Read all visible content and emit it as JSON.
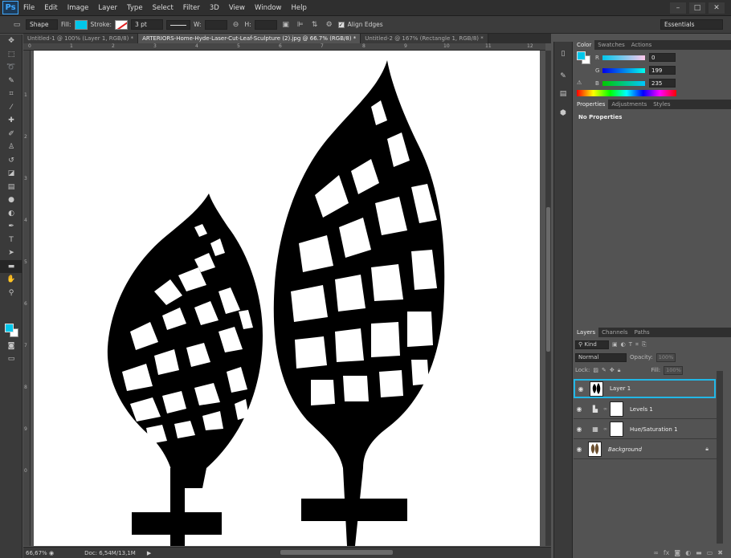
{
  "app": {
    "logo": "Ps"
  },
  "menu": [
    "File",
    "Edit",
    "Image",
    "Layer",
    "Type",
    "Select",
    "Filter",
    "3D",
    "View",
    "Window",
    "Help"
  ],
  "window_controls": [
    "–",
    "□",
    "✕"
  ],
  "options_bar": {
    "mode": "Shape",
    "fill_label": "Fill:",
    "stroke_label": "Stroke:",
    "stroke_width": "3 pt",
    "w_label": "W:",
    "h_label": "H:",
    "align_edges": "Align Edges",
    "workspace": "Essentials"
  },
  "doc_tabs": [
    "Untitled-1 @ 100% (Layer 1, RGB/8) *",
    "ARTERIORS-Home-Hyde-Laser-Cut-Leaf-Sculpture (2).jpg @ 66.7% (RGB/8) *",
    "Untitled-2 @ 167% (Rectangle 1, RGB/8) *"
  ],
  "ruler_top": [
    "0",
    "1",
    "2",
    "3",
    "4",
    "5",
    "6",
    "7",
    "8",
    "9",
    "10",
    "11",
    "12"
  ],
  "ruler_left": [
    "1",
    "2",
    "3",
    "4",
    "5",
    "6",
    "7",
    "8",
    "9",
    "0"
  ],
  "status": {
    "zoom": "66,67%",
    "doc": "Doc: 6,54M/13,1M"
  },
  "color_panel": {
    "tabs": [
      "Color",
      "Swatches",
      "Actions"
    ],
    "r_label": "R",
    "g_label": "G",
    "b_label": "B",
    "r": "0",
    "g": "199",
    "b": "235"
  },
  "properties_panel": {
    "tabs": [
      "Properties",
      "Adjustments",
      "Styles"
    ],
    "title": "No Properties"
  },
  "layers_panel": {
    "tabs": [
      "Layers",
      "Channels",
      "Paths"
    ],
    "kind": "Kind",
    "blend_mode": "Normal",
    "opacity_label": "Opacity:",
    "opacity": "100%",
    "lock_label": "Lock:",
    "fill_label": "Fill:",
    "fill": "100%",
    "layers": [
      {
        "name": "Layer 1",
        "selected": true,
        "type": "pixel"
      },
      {
        "name": "Levels 1",
        "selected": false,
        "type": "adjustment",
        "icon": "levels-icon"
      },
      {
        "name": "Hue/Saturation 1",
        "selected": false,
        "type": "adjustment",
        "icon": "hue-sat-icon"
      },
      {
        "name": "Background",
        "selected": false,
        "type": "background"
      }
    ]
  },
  "colors": {
    "accent": "#00c7eb",
    "selection": "#22b7e6"
  }
}
